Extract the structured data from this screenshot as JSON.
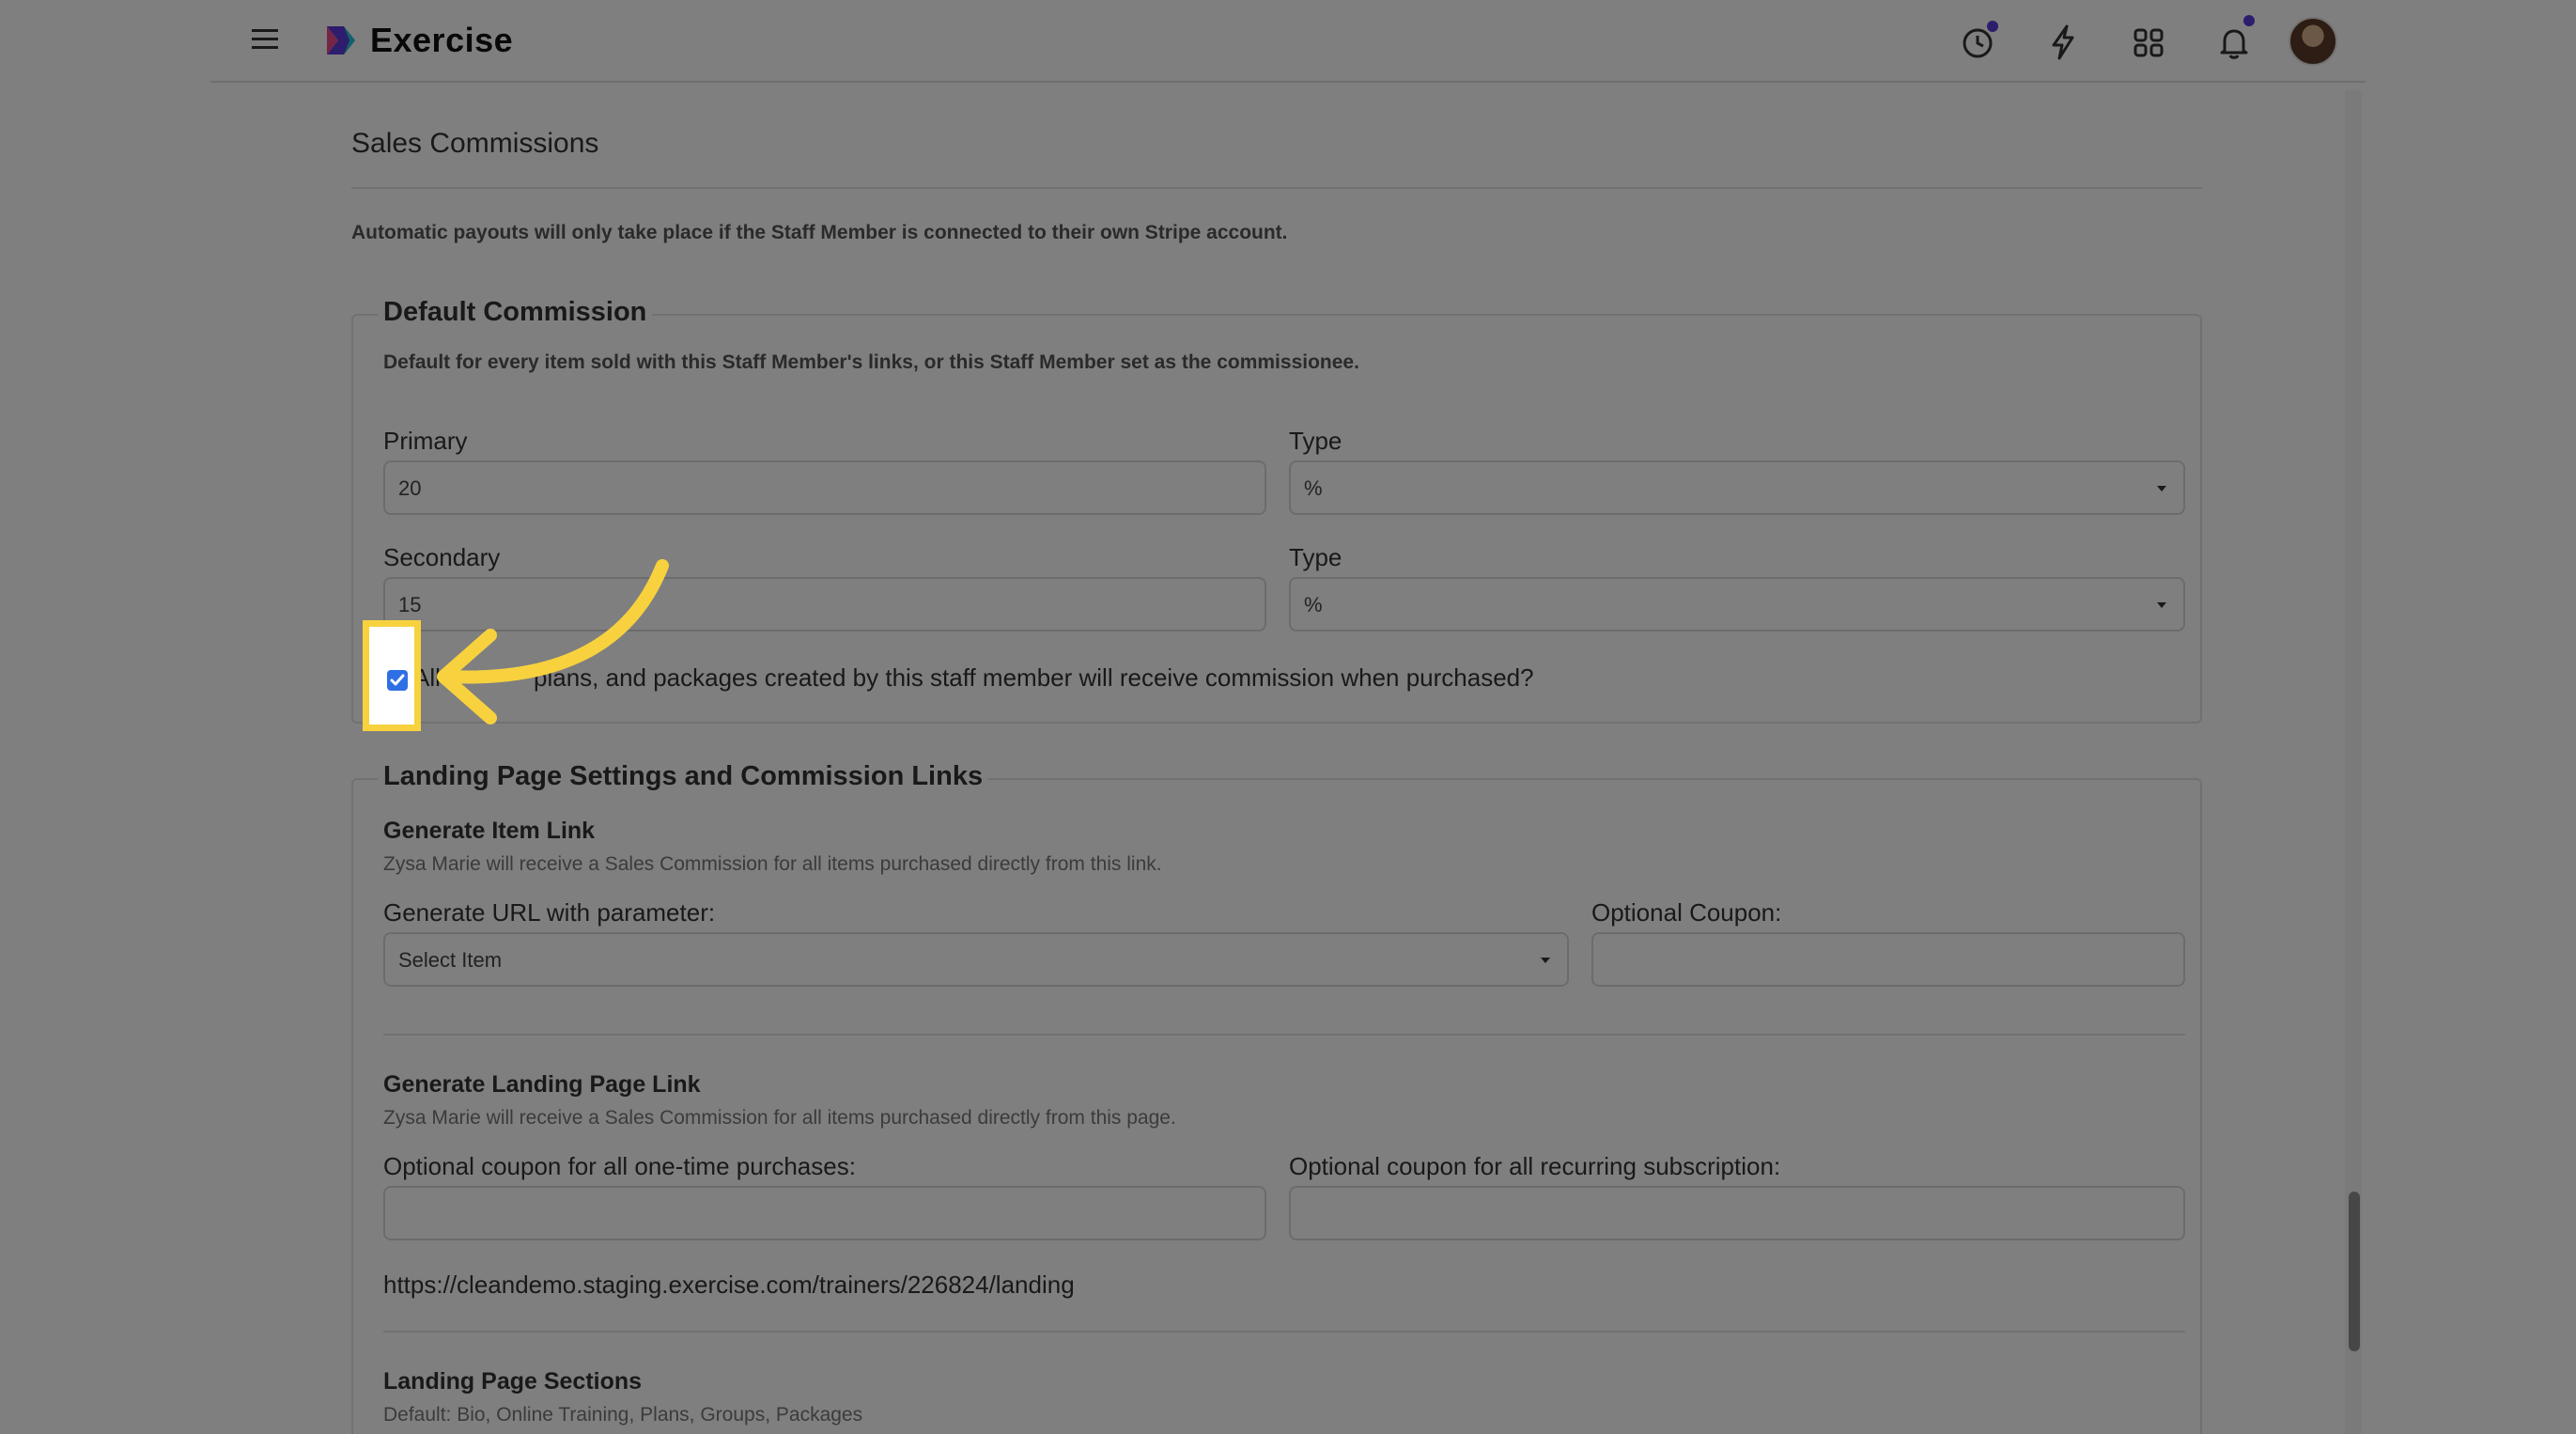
{
  "app": {
    "brand": "Exercise",
    "accent": "#f7d23e",
    "check_color": "#2f6fe4"
  },
  "header": {
    "icons": [
      "menu-icon",
      "logo-icon",
      "history-icon",
      "lightning-icon",
      "apps-grid-icon",
      "bell-icon",
      "avatar"
    ]
  },
  "page": {
    "section_title": "Sales Commissions",
    "payout_note": "Automatic payouts will only take place if the Staff Member is connected to their own Stripe account.",
    "default_commission": {
      "legend": "Default Commission",
      "description": "Default for every item sold with this Staff Member's links, or this Staff Member set as the commissionee.",
      "primary_label": "Primary",
      "primary_value": "20",
      "type_label": "Type",
      "primary_type_value": "%",
      "secondary_label": "Secondary",
      "secondary_value": "15",
      "secondary_type_value": "%",
      "checkbox_text_visible": "plans, and packages created by this staff member will receive commission when purchased?",
      "checkbox_lead": "All",
      "checkbox_checked": true
    },
    "landing": {
      "legend": "Landing Page Settings and Commission Links",
      "item_link_title": "Generate Item Link",
      "item_link_hint": "Zysa Marie will receive a Sales Commission for all items purchased directly from this link.",
      "url_param_label": "Generate URL with parameter:",
      "url_param_placeholder": "Select Item",
      "coupon_label": "Optional Coupon:",
      "coupon_value": "",
      "landing_link_title": "Generate Landing Page Link",
      "landing_link_hint": "Zysa Marie will receive a Sales Commission for all items purchased directly from this page.",
      "onetime_coupon_label": "Optional coupon for all one-time purchases:",
      "onetime_coupon_value": "",
      "recurring_coupon_label": "Optional coupon for all recurring subscription:",
      "recurring_coupon_value": "",
      "landing_url": "https://cleandemo.staging.exercise.com/trainers/226824/landing",
      "sections_title": "Landing Page Sections",
      "sections_hint": "Default: Bio, Online Training, Plans, Groups, Packages"
    }
  }
}
